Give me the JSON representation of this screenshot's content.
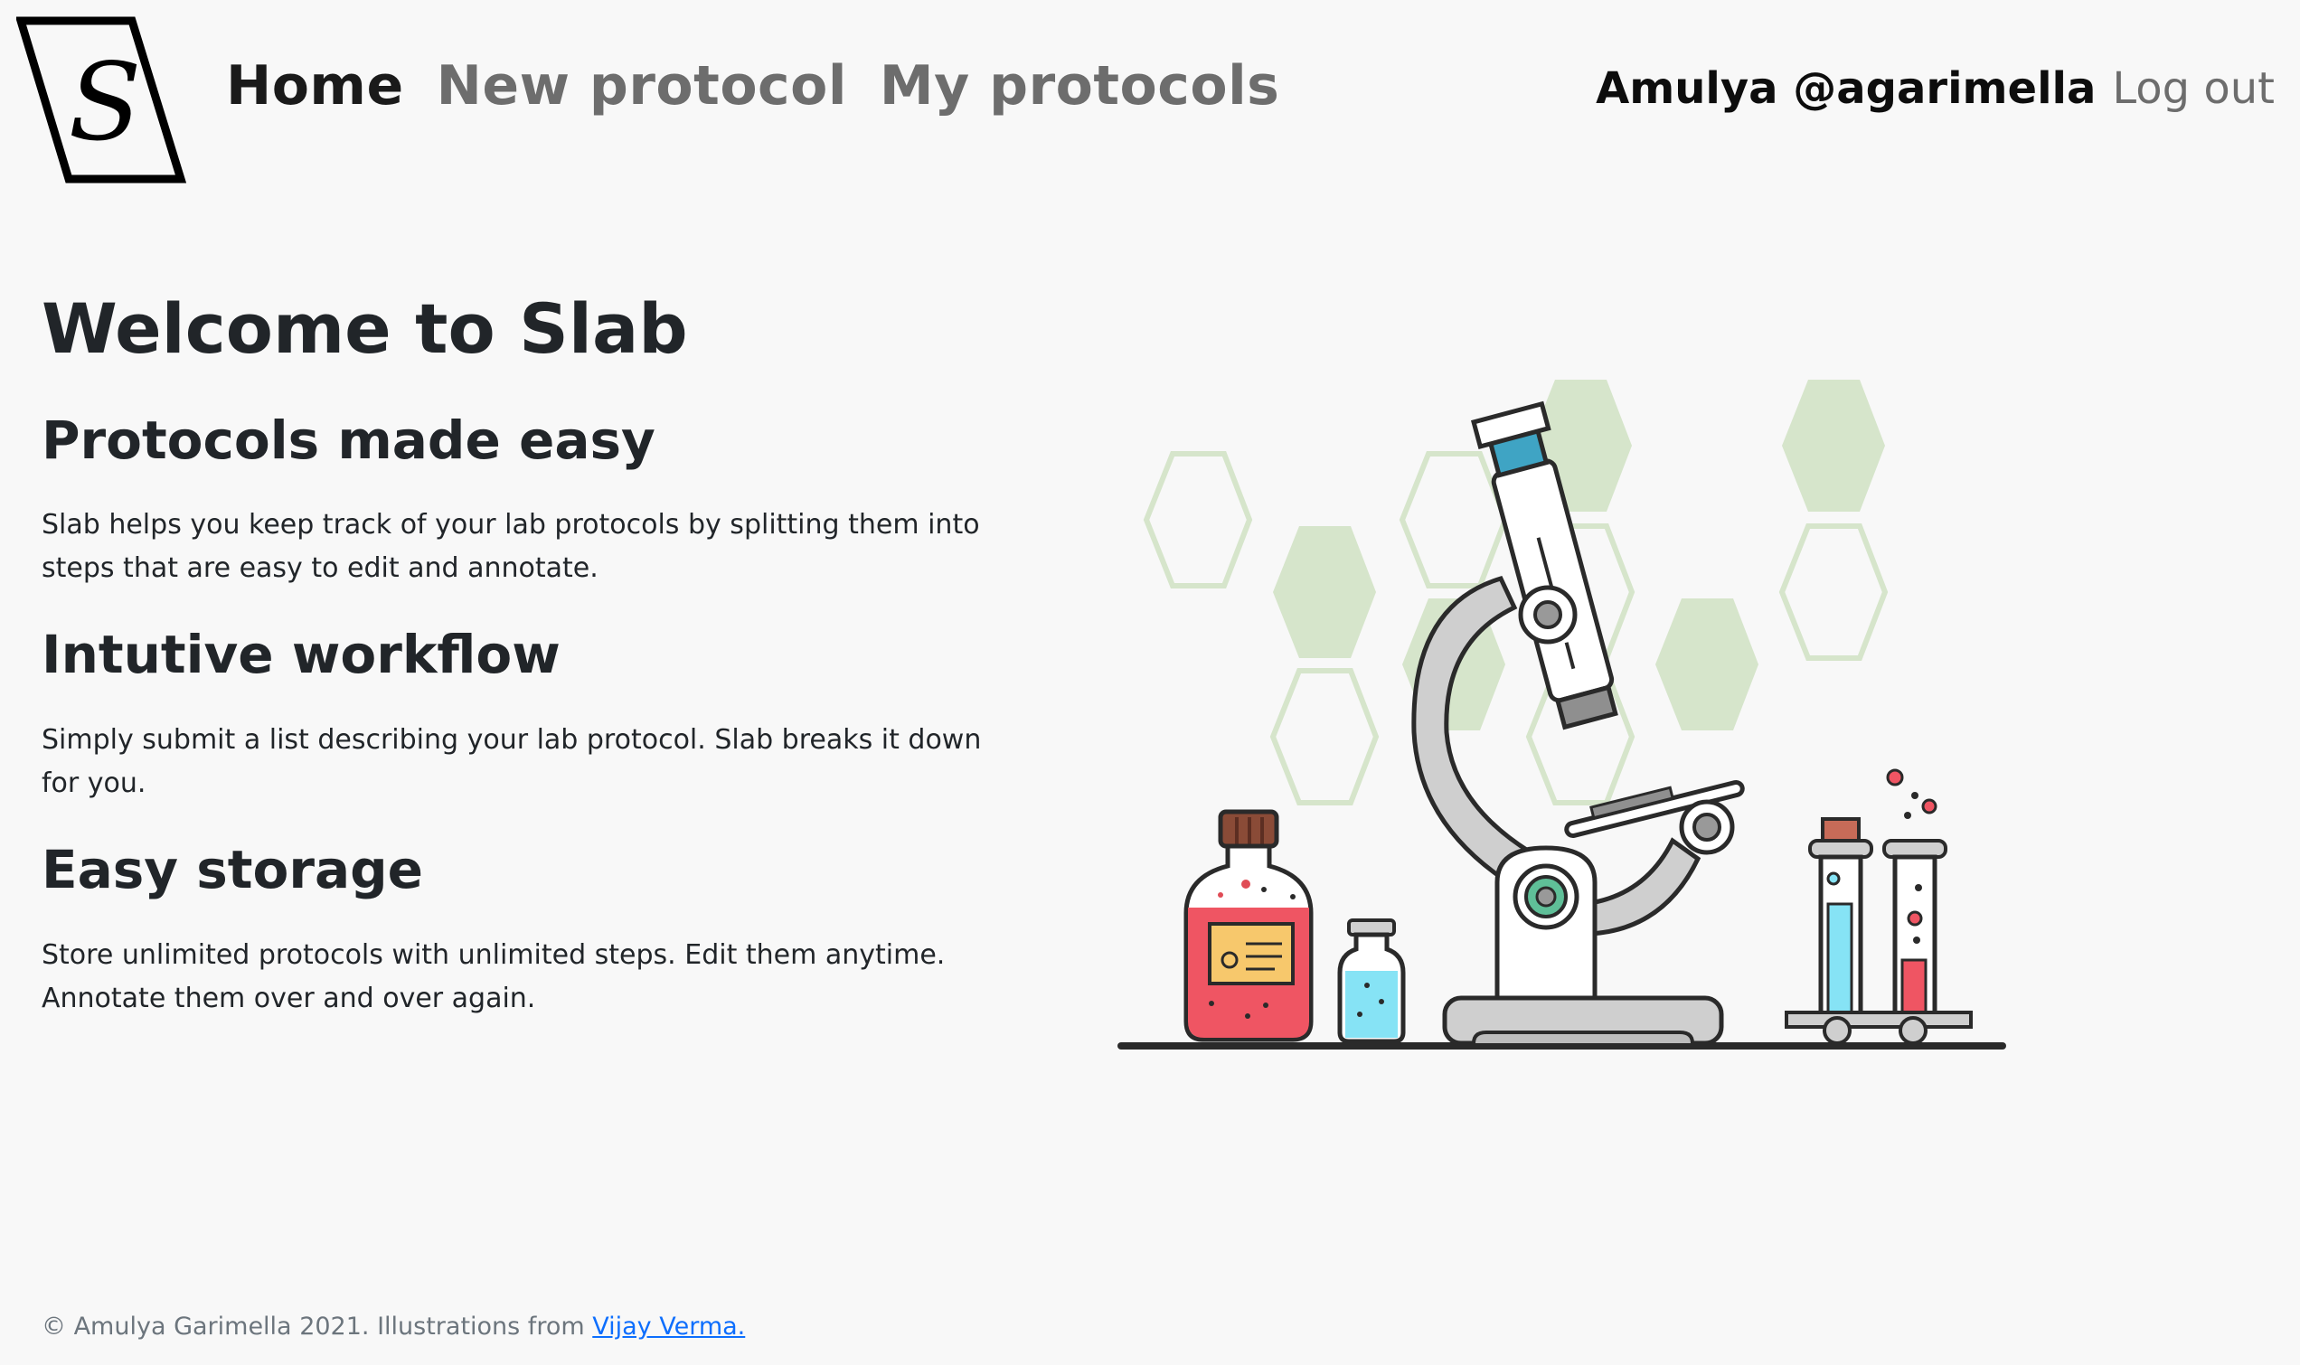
{
  "header": {
    "logo_letter": "S",
    "nav": {
      "home": "Home",
      "new_protocol": "New protocol",
      "my_protocols": "My protocols"
    },
    "user": "Amulya @agarimella",
    "logout": "Log out"
  },
  "main": {
    "title": "Welcome to Slab",
    "sections": [
      {
        "heading": "Protocols made easy",
        "text": "Slab helps you keep track of your lab protocols by splitting them into steps that are easy to edit and annotate."
      },
      {
        "heading": "Intutive workflow",
        "text": "Simply submit a list describing your lab protocol. Slab breaks it down for you."
      },
      {
        "heading": "Easy storage",
        "text": "Store unlimited protocols with unlimited steps. Edit them anytime. Annotate them over and over again."
      }
    ]
  },
  "footer": {
    "text": "© Amulya Garimella 2021. Illustrations from ",
    "link": "Vijay Verma."
  },
  "colors": {
    "background": "#f8f8f8",
    "nav_active": "#1a1a1a",
    "nav_inactive": "#6d6d6d",
    "hex_fill": "#d6e5cb",
    "link": "#0d6efd"
  },
  "icons": {
    "logo": "slab-logo-icon",
    "illustration": "lab-microscope-illustration"
  }
}
